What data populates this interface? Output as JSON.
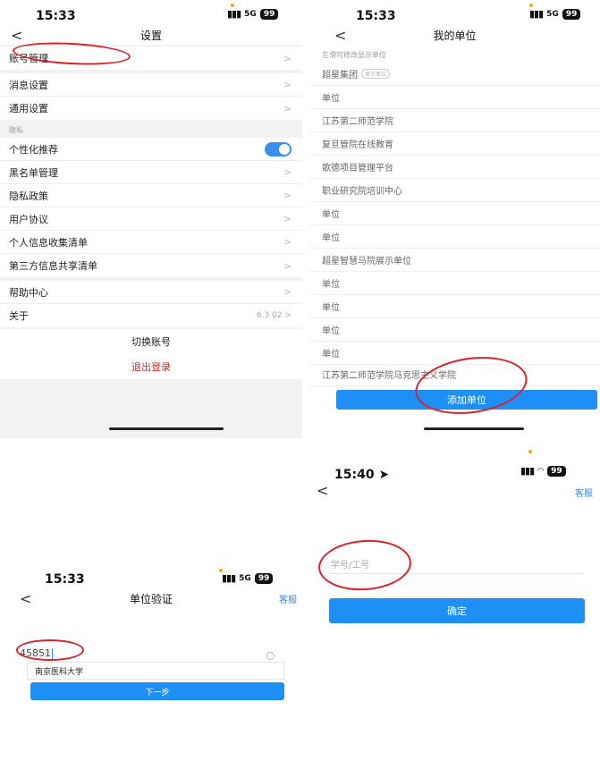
{
  "settings": {
    "time": "15:33",
    "network": "5G",
    "battery": "99",
    "title": "设置",
    "back": "<",
    "items": [
      {
        "label": "账号管理"
      },
      {
        "label": "消息设置"
      },
      {
        "label": "通用设置"
      }
    ],
    "privacy_header": "隐私",
    "privacy_items": [
      {
        "label": "个性化推荐"
      },
      {
        "label": "黑名单管理"
      },
      {
        "label": "隐私政策"
      },
      {
        "label": "用户协议"
      },
      {
        "label": "个人信息收集清单"
      },
      {
        "label": "第三方信息共享清单"
      }
    ],
    "help": "帮助中心",
    "about": "关于",
    "version": "6.3.02",
    "switch_account": "切换账号",
    "logout": "退出登录",
    "logout_color": "#e02020"
  },
  "units": {
    "time": "15:33",
    "network": "5G",
    "battery": "99",
    "title": "我的单位",
    "back": "<",
    "hint": "左滑可修改显示单位",
    "list": [
      {
        "label": "超星集团",
        "badge": "显示单位"
      },
      {
        "label": "单位"
      },
      {
        "label": "江苏第二师范学院"
      },
      {
        "label": "复旦管院在线教育"
      },
      {
        "label": "歌德项目管理平台"
      },
      {
        "label": "职业研究院培训中心"
      },
      {
        "label": "单位"
      },
      {
        "label": "单位"
      },
      {
        "label": "超星智慧马院展示单位"
      },
      {
        "label": "单位"
      },
      {
        "label": "单位"
      },
      {
        "label": "单位"
      },
      {
        "label": "单位"
      },
      {
        "label": "江苏第二师范学院马克思主义学院"
      }
    ],
    "add_button": "添加单位",
    "accent": "#1e90f5"
  },
  "verify": {
    "time": "15:33",
    "network": "5G",
    "battery": "99",
    "title": "单位验证",
    "back": "<",
    "service": "客服",
    "input_value": "45851",
    "suggestion": "南京医科大学",
    "next_button": "下一步"
  },
  "student": {
    "time": "15:40",
    "battery": "99",
    "back": "<",
    "service": "客服",
    "placeholder": "学号/工号",
    "confirm_button": "确定"
  },
  "annotation_color": "#d8232a"
}
